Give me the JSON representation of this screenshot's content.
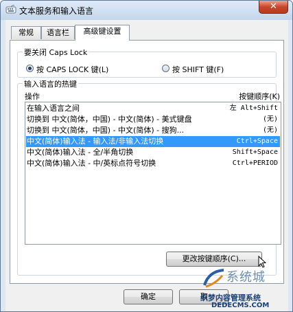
{
  "window": {
    "title": "文本服务和输入语言",
    "close_glyph": "✕"
  },
  "tabs": [
    {
      "label": "常规"
    },
    {
      "label": "语言栏"
    },
    {
      "label": "高级键设置"
    }
  ],
  "caps_group": {
    "label": "要关闭 Caps Lock",
    "options": [
      {
        "label": "按 CAPS LOCK 键(L)",
        "checked": true
      },
      {
        "label": "按 SHIFT 键(F)",
        "checked": false
      }
    ]
  },
  "hotkeys": {
    "label": "输入语言的热键",
    "columns": {
      "action": "操作",
      "sequence": "按键顺序(K)"
    },
    "rows": [
      {
        "action": "在输入语言之间",
        "keys": "左 Alt+Shift",
        "selected": false
      },
      {
        "action": "切换到 中文(简体，中国) - 中文(简体) - 美式键盘",
        "keys": "(无)",
        "selected": false
      },
      {
        "action": "切换到 中文(简体，中国) - 中文(简体) - 搜狗...",
        "keys": "(无)",
        "selected": false
      },
      {
        "action": "中文(简体)输入法 - 输入法/非输入法切换",
        "keys": "Ctrl+Space",
        "selected": true
      },
      {
        "action": "中文(简体)输入法 - 全/半角切换",
        "keys": "Shift+Space",
        "selected": false
      },
      {
        "action": "中文(简体)输入法 - 中/英标点符号切换",
        "keys": "Ctrl+PERIOD",
        "selected": false
      }
    ],
    "change_button": "更改按键顺序(C)..."
  },
  "buttons": {
    "ok": "确定",
    "cancel": "取"
  },
  "watermark": {
    "big": "系统城",
    "line1": "织梦内容管理系统",
    "line2": "DEDECMS.COM"
  },
  "colors": {
    "selection": "#3399ff",
    "title_gradient_top": "#dfeaf7",
    "close_red": "#c9462c"
  }
}
